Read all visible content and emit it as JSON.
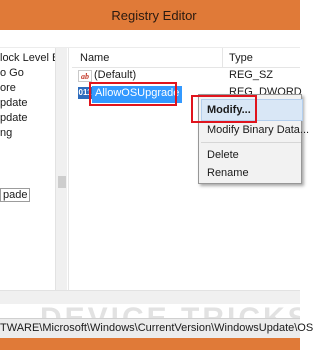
{
  "window": {
    "title": "Registry Editor"
  },
  "tree": {
    "items": [
      {
        "label": "lock Level B"
      },
      {
        "label": "o Go"
      },
      {
        "label": "ore"
      },
      {
        "label": "pdate"
      },
      {
        "label": "pdate"
      },
      {
        "label": "ng"
      },
      {
        "label": "pade"
      }
    ]
  },
  "list": {
    "columns": [
      "Name",
      "Type"
    ],
    "rows": [
      {
        "icon": "string-value-icon",
        "icon_text": "ab",
        "name": "(Default)",
        "type": "REG_SZ"
      },
      {
        "icon": "binary-value-icon",
        "icon_text": "011",
        "name": "AllowOSUpgrade",
        "type": "REG_DWORD"
      }
    ]
  },
  "context_menu": {
    "items": [
      {
        "label": "Modify..."
      },
      {
        "label": "Modify Binary Data..."
      },
      {
        "label": "Delete"
      },
      {
        "label": "Rename"
      }
    ]
  },
  "status": {
    "path": "TWARE\\Microsoft\\Windows\\CurrentVersion\\WindowsUpdate\\OS"
  },
  "watermark": {
    "text": "DEVICE TRICKS"
  },
  "colors": {
    "titlebar": "#e07a38",
    "selection": "#3399ff",
    "highlight_box": "#e0141d",
    "menu_hover": "#d9e7f6"
  }
}
